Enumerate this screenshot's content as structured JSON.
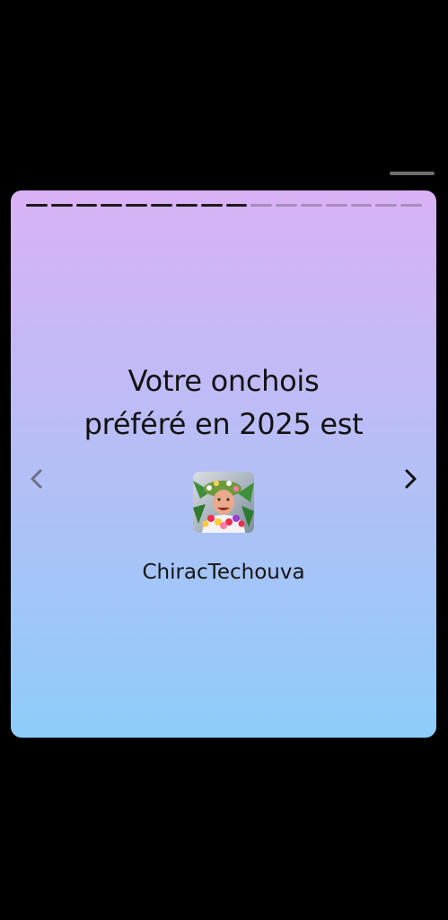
{
  "story": {
    "progress": {
      "total_segments": 16,
      "completed_segments": 9
    },
    "title_line1": "Votre onchois",
    "title_line2": "préféré en 2025 est",
    "username": "ChiracTechouva",
    "avatar_icon": "user-avatar-photo",
    "prev_icon": "chevron-left-icon",
    "next_icon": "chevron-right-icon"
  },
  "colors": {
    "background": "#000000",
    "gradient_top": "#d9b2f4",
    "gradient_bottom": "#8ecdf9",
    "text": "#121212",
    "prev_arrow": "#6f6f8a",
    "next_arrow": "#111111"
  }
}
